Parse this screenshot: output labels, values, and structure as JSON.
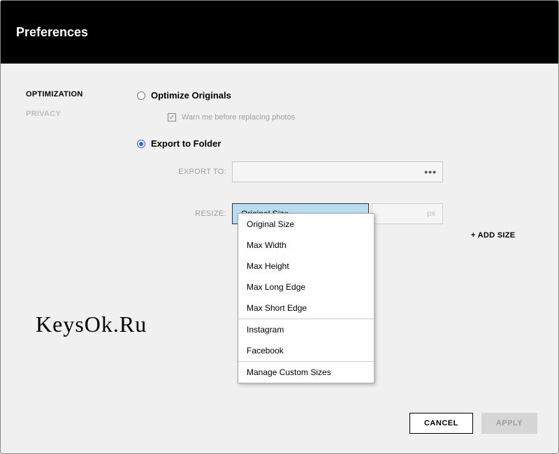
{
  "header": {
    "title": "Preferences"
  },
  "sidebar": {
    "items": [
      {
        "label": "OPTIMIZATION",
        "active": true
      },
      {
        "label": "PRIVACY",
        "active": false
      }
    ]
  },
  "main": {
    "radio_optimize": "Optimize Originals",
    "check_warn": "Warn me before replacing photos",
    "radio_export": "Export to Folder",
    "export_to_label": "EXPORT TO:",
    "resize_label": "RESIZE:",
    "resize_selected": "Original Size",
    "px_unit": "px",
    "add_size": "+ ADD SIZE",
    "dropdown": {
      "group1": [
        "Original Size",
        "Max Width",
        "Max Height",
        "Max Long Edge",
        "Max Short Edge"
      ],
      "group2": [
        "Instagram",
        "Facebook"
      ],
      "group3": [
        "Manage Custom Sizes"
      ]
    }
  },
  "footer": {
    "cancel": "CANCEL",
    "apply": "APPLY"
  },
  "watermark": "KeysOk.Ru"
}
